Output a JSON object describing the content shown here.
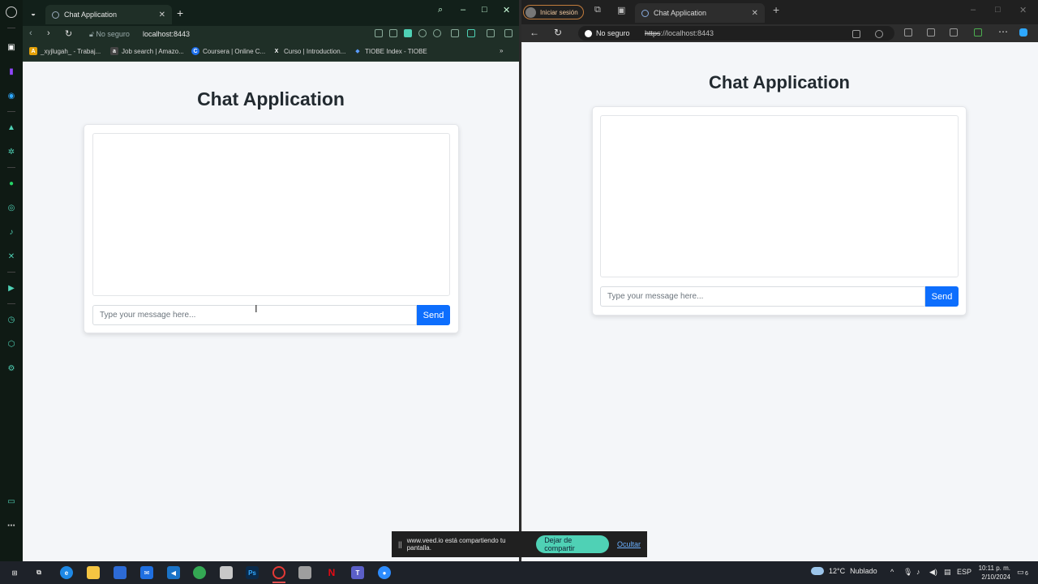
{
  "left_browser": {
    "tab_title": "Chat Application",
    "security_label": "No seguro",
    "url": "localhost:8443",
    "bookmarks": [
      {
        "label": "_xyjlugah_ - Trabaj...",
        "color": "#e3a008",
        "glyph": "A"
      },
      {
        "label": "Job search | Amazo...",
        "color": "#444444",
        "glyph": "a"
      },
      {
        "label": "Coursera | Online C...",
        "color": "#1f6feb",
        "glyph": "C"
      },
      {
        "label": "Curso | Introduction...",
        "color": "#333333",
        "glyph": "X"
      },
      {
        "label": "TIOBE Index - TIOBE",
        "color": "#3b82f6",
        "glyph": "◆"
      }
    ],
    "overflow_label": "»",
    "page": {
      "title": "Chat Application",
      "input_placeholder": "Type your message here...",
      "send_label": "Send"
    }
  },
  "right_browser": {
    "profile_label": "Iniciar sesión",
    "tab_title": "Chat Application",
    "security_label": "No seguro",
    "url_scheme": "https",
    "url_rest": "://localhost:8443",
    "page": {
      "title": "Chat Application",
      "input_placeholder": "Type your message here...",
      "send_label": "Send"
    }
  },
  "share_banner": {
    "text": "www.veed.io está compartiendo tu pantalla.",
    "stop_label": "Dejar de compartir",
    "hide_label": "Ocultar"
  },
  "taskbar": {
    "weather_temp": "12°C",
    "weather_desc": "Nublado",
    "language": "ESP",
    "time": "10:11 p. m.",
    "date": "2/10/2024",
    "notification_count": "6"
  },
  "colors": {
    "accent": "#0d6efd",
    "page_bg": "#f4f6f9",
    "share_button": "#4fd1b5"
  }
}
